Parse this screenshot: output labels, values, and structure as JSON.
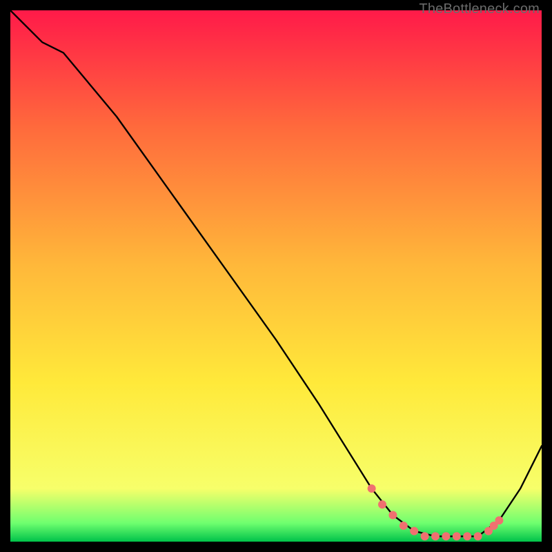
{
  "watermark": "TheBottleneck.com",
  "colors": {
    "top": "#ff1a49",
    "upper_mid": "#ff6a3c",
    "mid": "#ffb83a",
    "lower_mid": "#ffe93a",
    "near_bottom": "#f7ff6a",
    "bottom_band_top": "#6fff6f",
    "bottom_band_bottom": "#00c24a",
    "curve": "#000000",
    "marker": "#f07070",
    "bg": "#000000"
  },
  "chart_data": {
    "type": "line",
    "title": "",
    "xlabel": "",
    "ylabel": "",
    "xlim": [
      0,
      100
    ],
    "ylim": [
      0,
      100
    ],
    "grid": false,
    "legend": false,
    "series": [
      {
        "name": "bottleneck-curve",
        "x": [
          0,
          6,
          10,
          20,
          30,
          40,
          50,
          58,
          63,
          68,
          72,
          76,
          80,
          84,
          88,
          92,
          96,
          100
        ],
        "y": [
          100,
          94,
          92,
          80,
          66,
          52,
          38,
          26,
          18,
          10,
          5,
          2,
          1,
          1,
          1,
          4,
          10,
          18
        ]
      }
    ],
    "markers": {
      "name": "highlight-points",
      "x": [
        68,
        70,
        72,
        74,
        76,
        78,
        80,
        82,
        84,
        86,
        88,
        90,
        91,
        92
      ],
      "y": [
        10,
        7,
        5,
        3,
        2,
        1,
        1,
        1,
        1,
        1,
        1,
        2,
        3,
        4
      ]
    }
  }
}
